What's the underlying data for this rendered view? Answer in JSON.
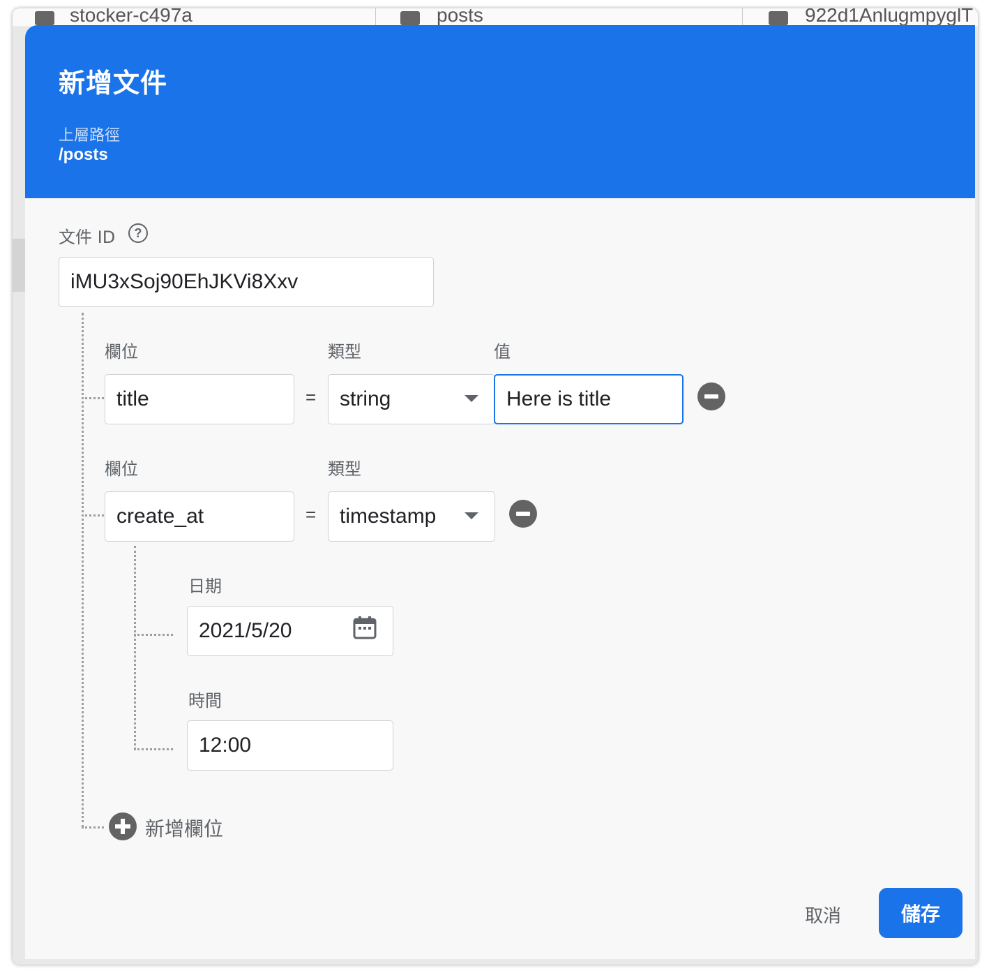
{
  "background": {
    "project": "stocker-c497a",
    "collection": "posts",
    "document": "922d1AnlugmpyglT"
  },
  "dialog": {
    "title": "新增文件",
    "parent_path_label": "上層路徑",
    "parent_path": "/posts",
    "doc_id_label": "文件 ID",
    "doc_id_value": "iMU3xSoj90EhJKVi8Xxv"
  },
  "fields": [
    {
      "field_label": "欄位",
      "type_label": "類型",
      "value_label": "值",
      "name": "title",
      "type": "string",
      "value": "Here is title"
    },
    {
      "field_label": "欄位",
      "type_label": "類型",
      "name": "create_at",
      "type": "timestamp",
      "date_label": "日期",
      "date_value": "2021/5/20",
      "time_label": "時間",
      "time_value": "12:00"
    }
  ],
  "equals": "=",
  "add_field_label": "新增欄位",
  "buttons": {
    "cancel": "取消",
    "save": "儲存"
  },
  "colors": {
    "accent": "#1a73e8",
    "icon_gray": "#636363"
  }
}
